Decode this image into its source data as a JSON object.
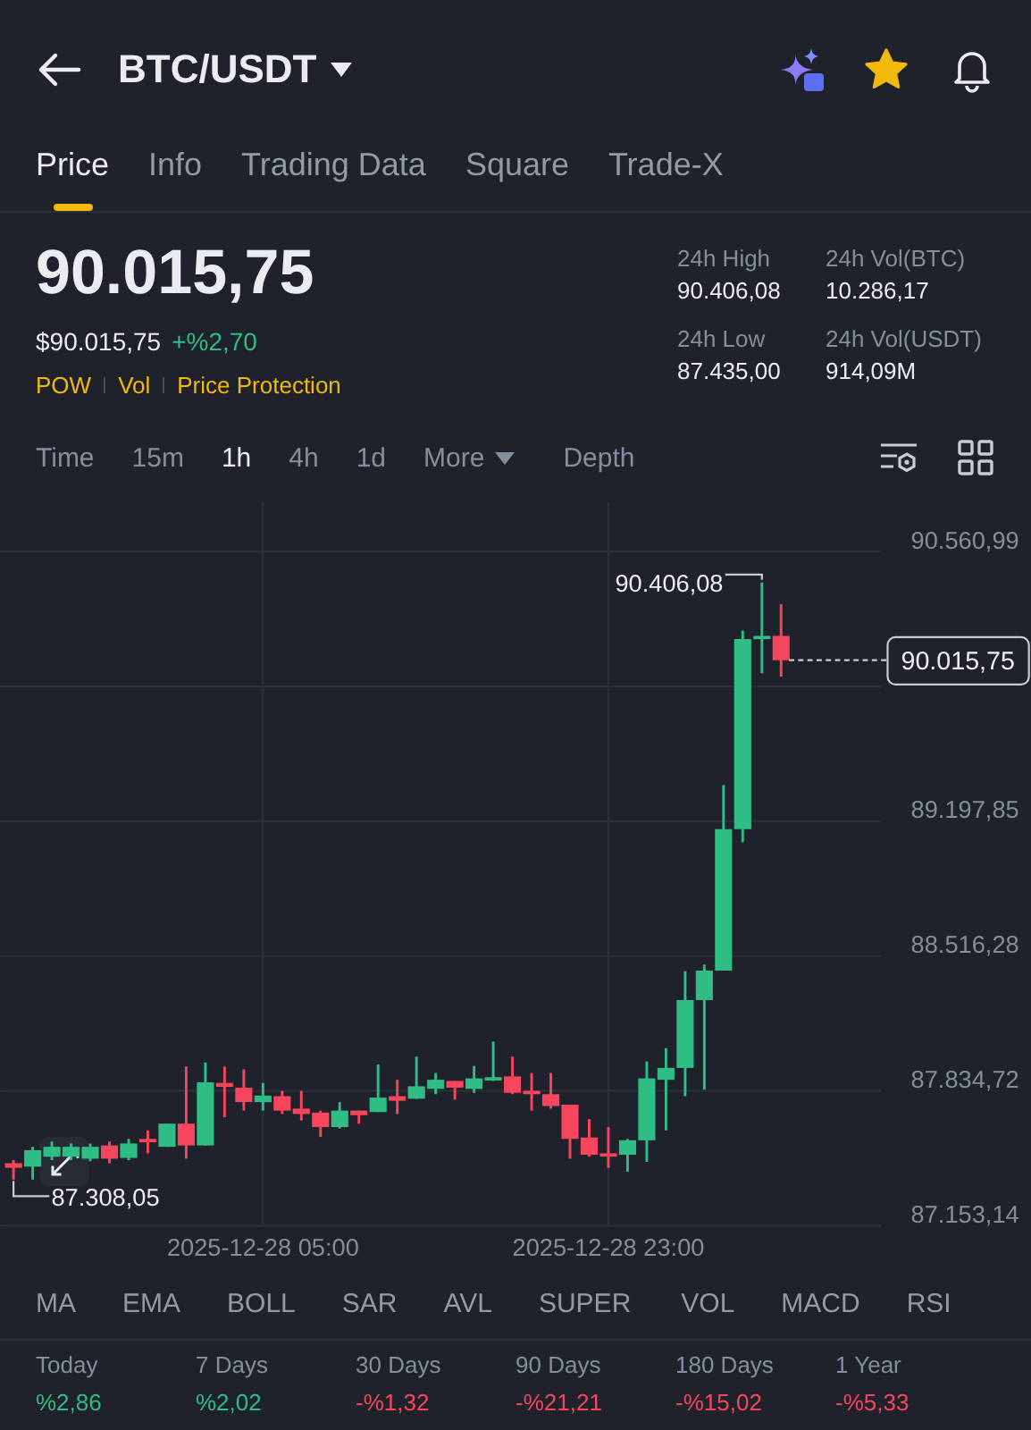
{
  "header": {
    "title": "BTC/USDT",
    "favorite": true
  },
  "tabs": [
    {
      "label": "Price",
      "selected": true
    },
    {
      "label": "Info",
      "selected": false
    },
    {
      "label": "Trading Data",
      "selected": false
    },
    {
      "label": "Square",
      "selected": false
    },
    {
      "label": "Trade-X",
      "selected": false
    }
  ],
  "price": {
    "last": "90.015,75",
    "fiat": "$90.015,75",
    "change": "+%2,70",
    "tags": [
      "POW",
      "Vol",
      "Price Protection"
    ]
  },
  "stats": [
    {
      "label": "24h High",
      "value": "90.406,08"
    },
    {
      "label": "24h Vol(BTC)",
      "value": "10.286,17"
    },
    {
      "label": "24h Low",
      "value": "87.435,00"
    },
    {
      "label": "24h Vol(USDT)",
      "value": "914,09M"
    }
  ],
  "intervals": [
    {
      "label": "Time",
      "kind": "plain",
      "selected": false
    },
    {
      "label": "15m",
      "kind": "plain",
      "selected": false
    },
    {
      "label": "1h",
      "kind": "plain",
      "selected": true
    },
    {
      "label": "4h",
      "kind": "plain",
      "selected": false
    },
    {
      "label": "1d",
      "kind": "plain",
      "selected": false
    },
    {
      "label": "More",
      "kind": "dropdown",
      "selected": false
    },
    {
      "label": "Depth",
      "kind": "view",
      "selected": false
    }
  ],
  "chart": {
    "high_marker": "90.406,08",
    "low_marker": "87.308,05",
    "current_price": "90.015,75",
    "chart_data": {
      "type": "candlestick",
      "categories": [
        null,
        null,
        null,
        null,
        null,
        null,
        null,
        null,
        null,
        null,
        null,
        null,
        null,
        "2025-12-28 05:00",
        null,
        null,
        null,
        null,
        null,
        null,
        null,
        null,
        null,
        null,
        null,
        null,
        null,
        null,
        null,
        null,
        null,
        "2025-12-28 23:00",
        null,
        null,
        null,
        null,
        null,
        null,
        null,
        null,
        null
      ],
      "grid": true,
      "ohlc": [
        [
          87469,
          87485,
          87386,
          87446
        ],
        [
          87452,
          87552,
          87386,
          87535
        ],
        [
          87502,
          87579,
          87485,
          87552
        ],
        [
          87502,
          87569,
          87485,
          87552
        ],
        [
          87492,
          87569,
          87479,
          87552
        ],
        [
          87559,
          87579,
          87469,
          87492
        ],
        [
          87496,
          87592,
          87485,
          87569
        ],
        [
          87592,
          87635,
          87519,
          87575
        ],
        [
          87552,
          87669,
          87552,
          87669
        ],
        [
          87669,
          87958,
          87492,
          87559
        ],
        [
          87559,
          87978,
          87559,
          87878
        ],
        [
          87875,
          87958,
          87702,
          87855
        ],
        [
          87851,
          87944,
          87735,
          87778
        ],
        [
          87778,
          87875,
          87735,
          87811
        ],
        [
          87808,
          87835,
          87718,
          87735
        ],
        [
          87745,
          87835,
          87685,
          87718
        ],
        [
          87725,
          87735,
          87602,
          87652
        ],
        [
          87652,
          87778,
          87645,
          87735
        ],
        [
          87735,
          87735,
          87669,
          87712
        ],
        [
          87728,
          87968,
          87728,
          87801
        ],
        [
          87808,
          87891,
          87718,
          87785
        ],
        [
          87795,
          88008,
          87795,
          87858
        ],
        [
          87845,
          87925,
          87818,
          87891
        ],
        [
          87885,
          87885,
          87791,
          87851
        ],
        [
          87845,
          87961,
          87825,
          87898
        ],
        [
          87888,
          88084,
          87885,
          87904
        ],
        [
          87908,
          88008,
          87818,
          87825
        ],
        [
          87835,
          87925,
          87735,
          87818
        ],
        [
          87818,
          87925,
          87745,
          87758
        ],
        [
          87765,
          87765,
          87492,
          87592
        ],
        [
          87599,
          87692,
          87502,
          87512
        ],
        [
          87519,
          87652,
          87446,
          87506
        ],
        [
          87512,
          87592,
          87426,
          87585
        ],
        [
          87585,
          87984,
          87476,
          87898
        ],
        [
          87891,
          88051,
          87635,
          87951
        ],
        [
          87951,
          88440,
          87808,
          88294
        ],
        [
          88294,
          88473,
          87841,
          88443
        ],
        [
          88443,
          89381,
          88443,
          89158
        ],
        [
          89158,
          90162,
          89092,
          90119
        ],
        [
          90119,
          90405,
          89946,
          90135
        ],
        [
          90135,
          90295,
          89929,
          90012
        ]
      ],
      "ylim": [
        87153.14,
        90810.35
      ],
      "yticks": [
        {
          "value": 90560.99,
          "label": "90.560,99"
        },
        {
          "value": 89197.85,
          "label": "89.197,85"
        },
        {
          "value": 88516.28,
          "label": "88.516,28"
        },
        {
          "value": 87834.72,
          "label": "87.834,72"
        },
        {
          "value": 87153.14,
          "label": "87.153,14"
        }
      ]
    }
  },
  "indicators": {
    "main": [
      "MA",
      "EMA",
      "BOLL",
      "SAR",
      "AVL",
      "SUPER"
    ],
    "sub": [
      "VOL",
      "MACD",
      "RSI"
    ]
  },
  "performance": [
    {
      "period": "Today",
      "value": "%2,86",
      "color": "#2ebd85"
    },
    {
      "period": "7 Days",
      "value": "%2,02",
      "color": "#2ebd85"
    },
    {
      "period": "30 Days",
      "value": "-%1,32",
      "color": "#f6465d"
    },
    {
      "period": "90 Days",
      "value": "-%21,21",
      "color": "#f6465d"
    },
    {
      "period": "180 Days",
      "value": "-%15,02",
      "color": "#f6465d"
    },
    {
      "period": "1 Year",
      "value": "-%5,33",
      "color": "#f6465d"
    }
  ]
}
